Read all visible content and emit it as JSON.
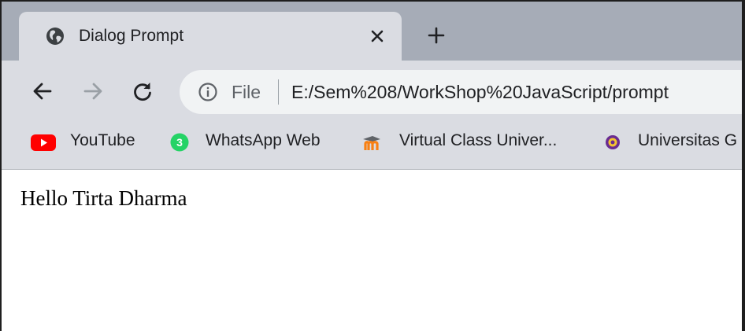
{
  "tab": {
    "title": "Dialog Prompt",
    "favicon": "globe-icon",
    "close": "close-icon"
  },
  "new_tab": "plus-icon",
  "toolbar": {
    "back": "arrow-left-icon",
    "forward": "arrow-right-icon",
    "reload": "reload-icon",
    "omnibox": {
      "security_icon": "info-icon",
      "scheme_label": "File",
      "url": "E:/Sem%208/WorkShop%20JavaScript/prompt"
    }
  },
  "bookmarks": [
    {
      "label": "YouTube",
      "icon": "youtube-icon"
    },
    {
      "label": "WhatsApp Web",
      "icon": "whatsapp-icon",
      "badge": "3"
    },
    {
      "label": "Virtual Class Univer...",
      "icon": "moodle-icon"
    },
    {
      "label": "Universitas G",
      "icon": "university-icon"
    }
  ],
  "page": {
    "text": "Hello Tirta Dharma"
  },
  "colors": {
    "tabstrip": "#a6acb7",
    "toolbar": "#dadce2",
    "omnibox": "#f1f3f4",
    "youtube_red": "#ff0000",
    "whatsapp_green": "#25d366",
    "moodle_orange": "#f98012"
  }
}
